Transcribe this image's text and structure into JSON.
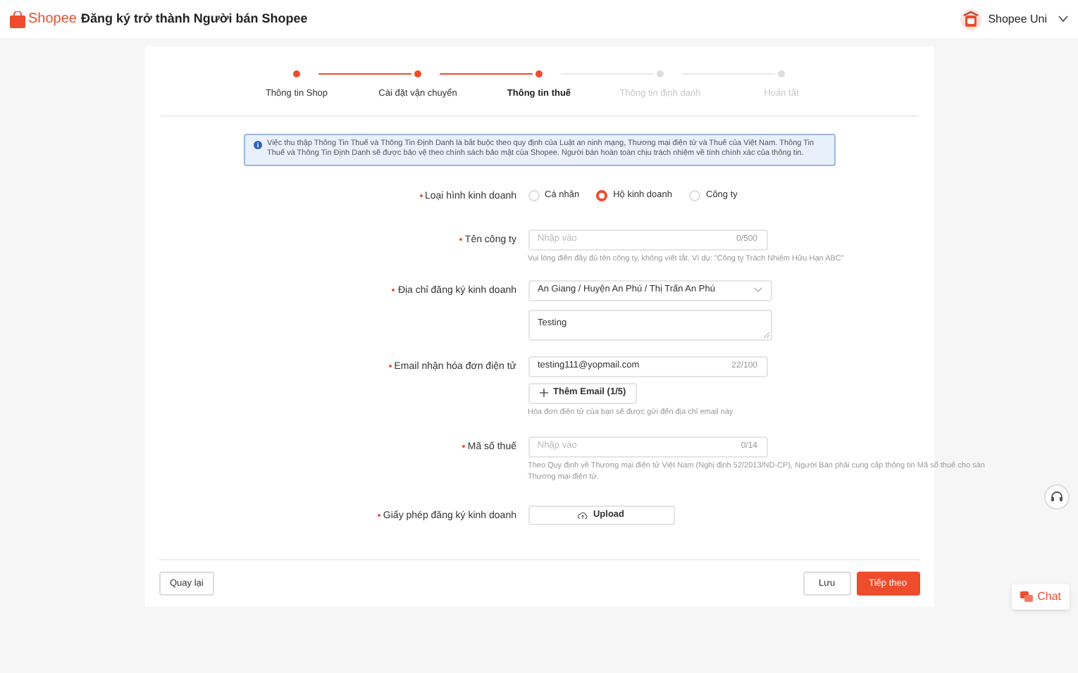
{
  "header": {
    "logo": "Shopee",
    "title": "Đăng ký trở thành Người bán Shopee",
    "account": "Shopee Uni"
  },
  "steps": [
    {
      "label": "Thông tin Shop",
      "completed": true,
      "selected": false
    },
    {
      "label": "Cài đặt vận chuyển",
      "completed": true,
      "selected": false
    },
    {
      "label": "Thông tin thuế",
      "completed": true,
      "selected": true
    },
    {
      "label": "Thông tin định danh",
      "completed": false,
      "selected": false
    },
    {
      "label": "Hoàn tất",
      "completed": false,
      "selected": false
    }
  ],
  "notice": "Việc thu thập Thông Tin Thuế và Thông Tin Định Danh là bắt buộc theo quy định của Luật an ninh mạng, Thương mại điện tử và Thuế của Việt Nam. Thông Tin Thuế và Thông Tin Định Danh sẽ được bảo vệ theo chính sách bảo mật của Shopee. Người bán hoàn toàn chịu trách nhiệm về tính chính xác của thông tin.",
  "form": [
    {
      "kind": "radio",
      "label": "Loại hình kinh doanh",
      "options": [
        {
          "label": "Cá nhân",
          "selected": false
        },
        {
          "label": "Hộ kinh doanh",
          "selected": true
        },
        {
          "label": "Công ty",
          "selected": false
        }
      ]
    },
    {
      "kind": "input",
      "label": "Tên công ty",
      "placeholder": "Nhập vào",
      "counter": "0/500",
      "hint": "Vui lòng điền đầy đủ tên công ty, không viết tắt. Ví dụ: \"Công ty Trách Nhiệm Hữu Hạn ABC\""
    },
    {
      "kind": "address",
      "label": "Địa chỉ đăng ký kinh doanh",
      "select": "An Giang / Huyện An Phú / Thị Trấn An Phú",
      "detail": "Testing"
    },
    {
      "kind": "email",
      "label": "Email nhận hóa đơn điện tử",
      "value": "testing111@yopmail.com",
      "counter": "22/100",
      "add_button": "Thêm Email (1/5)",
      "hint": "Hóa đơn điện tử của bạn sẽ được gửi đến địa chỉ email này"
    },
    {
      "kind": "input",
      "label": "Mã số thuế",
      "placeholder": "Nhập vào",
      "counter": "0/14",
      "hint": "Theo Quy định về Thương mại điện tử Việt Nam (Nghị định 52/2013/ND-CP), Người Bán phải cung cấp thông tin Mã số thuế cho sàn Thương mại điện tử."
    },
    {
      "kind": "upload",
      "label": "Giấy phép đăng ký kinh doanh",
      "button": "Upload"
    }
  ],
  "footer": {
    "back": "Quay lại",
    "save": "Lưu",
    "next": "Tiếp theo"
  },
  "chat": "Chat"
}
